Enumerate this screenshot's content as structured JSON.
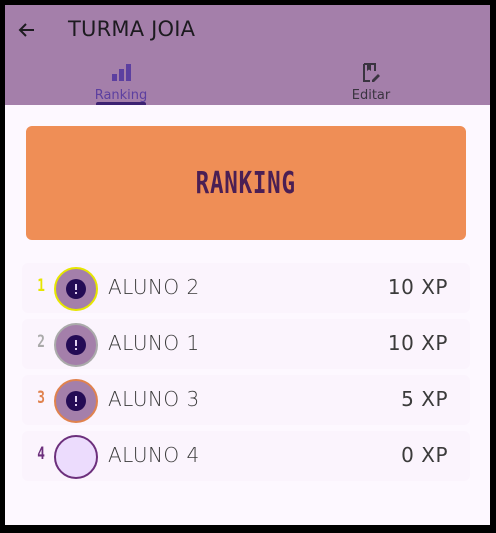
{
  "appbar": {
    "title": "TURMA JOIA",
    "back_icon": "arrow-left-icon"
  },
  "tabs": [
    {
      "label": "Ranking",
      "icon": "bar-chart-icon",
      "selected": true
    },
    {
      "label": "Editar",
      "icon": "edit-note-icon",
      "selected": false
    }
  ],
  "banner": {
    "label": "RANKING",
    "color": "#ef8e56"
  },
  "ranking": [
    {
      "position": "1",
      "name": "ALUNO 2",
      "xp": "10 XP",
      "pos_color": "#e6e600",
      "ring_color": "#e6e600",
      "fill": "#a47faa",
      "icon": "alert-icon"
    },
    {
      "position": "2",
      "name": "ALUNO 1",
      "xp": "10 XP",
      "pos_color": "#aaaaaa",
      "ring_color": "#aaaaaa",
      "fill": "#a47faa",
      "icon": "alert-icon"
    },
    {
      "position": "3",
      "name": "ALUNO 3",
      "xp": "5 XP",
      "pos_color": "#e0824e",
      "ring_color": "#e0824e",
      "fill": "#a47faa",
      "icon": "alert-icon"
    },
    {
      "position": "4",
      "name": "ALUNO 4",
      "xp": "0 XP",
      "pos_color": "#6c2f7c",
      "ring_color": "#6c2f7c",
      "fill": "#ecdcfd",
      "icon": ""
    }
  ]
}
